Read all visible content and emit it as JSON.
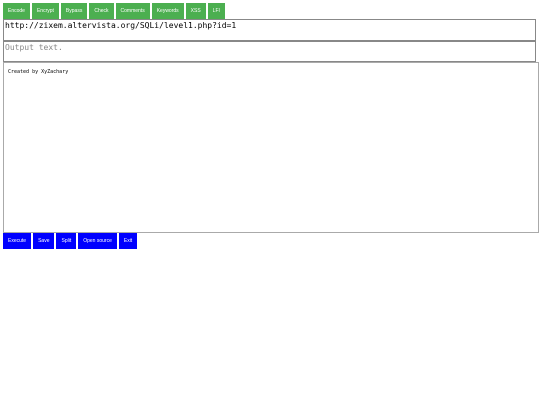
{
  "top_tabs": [
    {
      "label": "Encode"
    },
    {
      "label": "Encrypt"
    },
    {
      "label": "Bypass"
    },
    {
      "label": "Check"
    },
    {
      "label": "Comments"
    },
    {
      "label": "Keywords"
    },
    {
      "label": "XSS"
    },
    {
      "label": "LFI"
    }
  ],
  "url_input": {
    "value": "http://zixem.altervista.org/SQLi/level1.php?id=1"
  },
  "output_input": {
    "placeholder": "Output text."
  },
  "result": {
    "credit": "Created by XyZachary"
  },
  "actions": [
    {
      "label": "Execute"
    },
    {
      "label": "Save"
    },
    {
      "label": "Split"
    },
    {
      "label": "Open source"
    },
    {
      "label": "Exit"
    }
  ],
  "colors": {
    "tab_green": "#4caf50",
    "action_blue": "#0000ff"
  }
}
